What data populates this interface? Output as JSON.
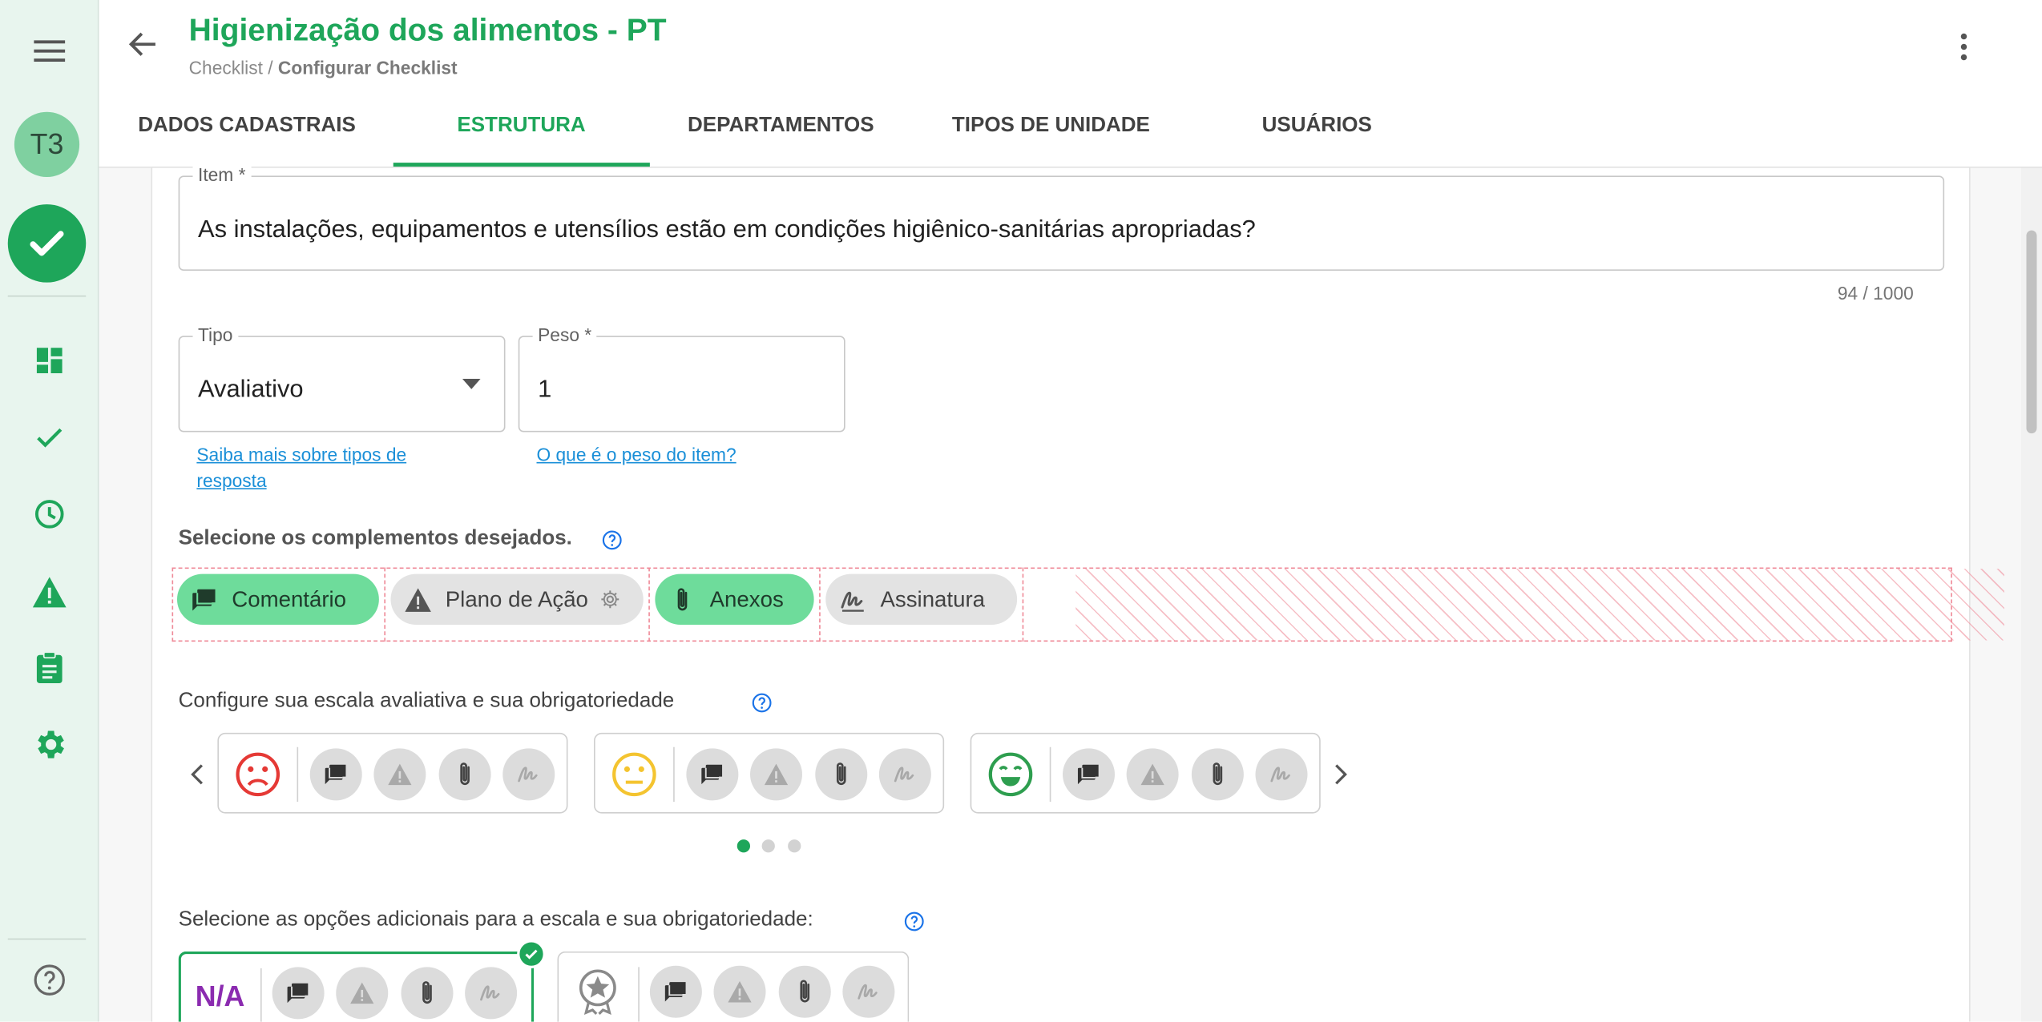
{
  "app": {
    "title": "Higienização dos alimentos - PT",
    "breadcrumb_root": "Checklist / ",
    "breadcrumb_current": "Configurar Checklist"
  },
  "sidebar": {
    "avatar_initials": "T3",
    "items": [
      {
        "icon": "dashboard-icon"
      },
      {
        "icon": "check-icon"
      },
      {
        "icon": "clock-icon"
      },
      {
        "icon": "warning-icon"
      },
      {
        "icon": "clipboard-icon"
      },
      {
        "icon": "gear-icon"
      }
    ],
    "help_icon": "help-icon"
  },
  "tabs": [
    {
      "label": "DADOS CADASTRAIS",
      "active": false
    },
    {
      "label": "ESTRUTURA",
      "active": true
    },
    {
      "label": "DEPARTAMENTOS",
      "active": false
    },
    {
      "label": "TIPOS DE UNIDADE",
      "active": false
    },
    {
      "label": "USUÁRIOS",
      "active": false
    }
  ],
  "form": {
    "item_label": "Item *",
    "item_value": "As instalações, equipamentos e utensílios estão em condições higiênico-sanitárias apropriadas?",
    "item_counter": "94 / 1000",
    "tipo_label": "Tipo",
    "tipo_value": "Avaliativo",
    "tipo_help_link": "Saiba mais sobre tipos de resposta",
    "peso_label": "Peso *",
    "peso_value": "1",
    "peso_help_link": "O que é o peso do item?"
  },
  "complements": {
    "label": "Selecione os complementos desejados.",
    "chips": [
      {
        "label": "Comentário",
        "selected": true,
        "icon": "comment-icon"
      },
      {
        "label": "Plano de Ação",
        "selected": false,
        "icon": "warning-icon"
      },
      {
        "label": "Anexos",
        "selected": true,
        "icon": "paperclip-icon"
      },
      {
        "label": "Assinatura",
        "selected": false,
        "icon": "signature-icon"
      }
    ]
  },
  "scale": {
    "label": "Configure sua escala avaliativa e sua obrigatoriedade",
    "items": [
      {
        "face": "sad-face-icon",
        "color": "#e53935"
      },
      {
        "face": "neutral-face-icon",
        "color": "#f4c430"
      },
      {
        "face": "happy-face-icon",
        "color": "#2e9e4f"
      }
    ],
    "page_count": 3,
    "current_page": 1
  },
  "additional": {
    "label": "Selecione as opções adicionais para a escala e sua obrigatoriedade:",
    "options": [
      {
        "label": "N/A",
        "selected": true
      },
      {
        "icon": "star-badge-icon",
        "selected": false
      }
    ]
  },
  "colors": {
    "accent": "#1ea65a",
    "chip_selected": "#6edc9b",
    "link": "#1a8fd8",
    "na_purple": "#8b2bb0"
  }
}
